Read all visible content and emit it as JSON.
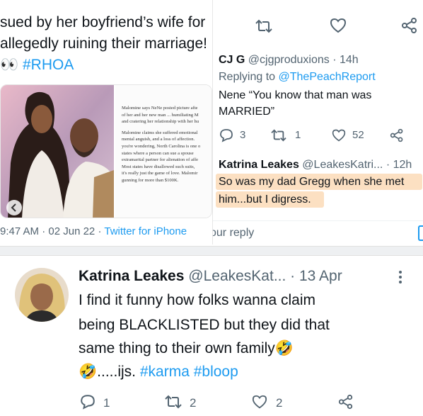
{
  "left_tweet": {
    "text_lines": [
      "sued by her boyfriend’s wife for",
      "allegedly ruining their marriage!"
    ],
    "emoji": "👀",
    "hashtag": "#RHOA",
    "article_paragraphs": [
      [
        "Malomine says NeNe posted picture afte",
        "of her and her new man ... humiliating M",
        "and cratering her relationship with her hu"
      ],
      [
        "Malomine claims she suffered emotional",
        "mental anguish, and a loss of affection.",
        "you're wondering, North Carolina is one o",
        "states where a person can sue a spouse",
        "extramarital partner for alienation of affe",
        "Most states have disallowed such suits,",
        "it's really just the game of love. Malomir",
        "gunning for more than $100K."
      ]
    ],
    "time": "9:47 AM",
    "date": "02 Jun 22",
    "source": "Twitter for iPhone",
    "sep": "·"
  },
  "right_thread": {
    "top_actions": [
      "retweet-icon",
      "heart-icon",
      "share-icon"
    ],
    "reply1": {
      "name": "CJ G",
      "handle": "@cjgproduxions",
      "time": "· 14h",
      "replying_label": "Replying to",
      "replying_to": "@ThePeachReport",
      "text_lines": [
        "Nene “You know that man was",
        "MARRIED”"
      ],
      "replies": "3",
      "retweets": "1",
      "likes": "52"
    },
    "reply2": {
      "name": "Katrina Leakes",
      "handle": "@LeakesKatri...",
      "time": "· 12h",
      "text_lines": [
        "So was my dad Gregg when she met",
        "him...but I digress."
      ],
      "highlight_color": "#fce0c2"
    },
    "reply_placeholder": "our reply"
  },
  "bottom_tweet": {
    "name": "Katrina Leakes",
    "handle": "@LeakesKat...",
    "time": "· 13 Apr",
    "line1": "I find it funny how folks wanna claim",
    "line2": "being BLACKLISTED but they did that",
    "line3": "same thing to their own family",
    "emoji": "🤣",
    "line4_text": ".....ijs.",
    "hashtag1": "#karma",
    "hashtag2": "#bloop",
    "replies": "1",
    "retweets": "2",
    "likes": "2"
  },
  "colors": {
    "accent": "#1d9bf0",
    "secondary_text": "#536471",
    "divider": "#eef0f2"
  }
}
